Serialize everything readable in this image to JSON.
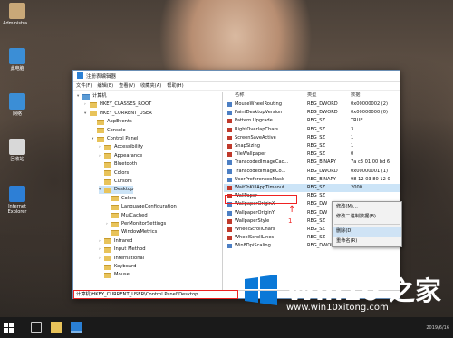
{
  "desktop": {
    "icons": [
      {
        "label": "Administra...",
        "color": "#c9a878"
      },
      {
        "label": "此电脑",
        "color": "#3b8ed6"
      },
      {
        "label": "网络",
        "color": "#3b8ed6"
      },
      {
        "label": "回收站",
        "color": "#d8d8d8"
      },
      {
        "label": "Internet Explorer",
        "color": "#2d7fd6"
      }
    ]
  },
  "window": {
    "title": "注册表编辑器",
    "menu": [
      "文件(F)",
      "编辑(E)",
      "查看(V)",
      "收藏夹(A)",
      "帮助(H)"
    ],
    "status_path": "计算机\\HKEY_CURRENT_USER\\Control Panel\\Desktop"
  },
  "tree": [
    {
      "label": "计算机",
      "exp": "▾",
      "level": 0
    },
    {
      "label": "HKEY_CLASSES_ROOT",
      "exp": "›",
      "level": 1
    },
    {
      "label": "HKEY_CURRENT_USER",
      "exp": "▾",
      "level": 1
    },
    {
      "label": "AppEvents",
      "exp": "›",
      "level": 2
    },
    {
      "label": "Console",
      "exp": "›",
      "level": 2
    },
    {
      "label": "Control Panel",
      "exp": "▾",
      "level": 2
    },
    {
      "label": "Accessibility",
      "exp": "›",
      "level": 3
    },
    {
      "label": "Appearance",
      "exp": "›",
      "level": 3
    },
    {
      "label": "Bluetooth",
      "exp": "",
      "level": 3
    },
    {
      "label": "Colors",
      "exp": "",
      "level": 3
    },
    {
      "label": "Cursors",
      "exp": "",
      "level": 3
    },
    {
      "label": "Desktop",
      "exp": "▾",
      "level": 3,
      "selected": true
    },
    {
      "label": "Colors",
      "exp": "",
      "level": 4
    },
    {
      "label": "LanguageConfiguration",
      "exp": "",
      "level": 4
    },
    {
      "label": "MuiCached",
      "exp": "",
      "level": 4
    },
    {
      "label": "PerMonitorSettings",
      "exp": "›",
      "level": 4
    },
    {
      "label": "WindowMetrics",
      "exp": "",
      "level": 4
    },
    {
      "label": "Infrared",
      "exp": "›",
      "level": 3
    },
    {
      "label": "Input Method",
      "exp": "›",
      "level": 3
    },
    {
      "label": "International",
      "exp": "›",
      "level": 3
    },
    {
      "label": "Keyboard",
      "exp": "",
      "level": 3
    },
    {
      "label": "Mouse",
      "exp": "",
      "level": 3
    }
  ],
  "values_header": {
    "name": "名称",
    "type": "类型",
    "data": "数据"
  },
  "values": [
    {
      "name": "MouseWheelRouting",
      "type": "REG_DWORD",
      "data": "0x00000002 (2)"
    },
    {
      "name": "PaintDesktopVersion",
      "type": "REG_DWORD",
      "data": "0x00000000 (0)"
    },
    {
      "name": "Pattern Upgrade",
      "type": "REG_SZ",
      "data": "TRUE"
    },
    {
      "name": "RightOverlapChars",
      "type": "REG_SZ",
      "data": "3"
    },
    {
      "name": "ScreenSaveActive",
      "type": "REG_SZ",
      "data": "1"
    },
    {
      "name": "SnapSizing",
      "type": "REG_SZ",
      "data": "1"
    },
    {
      "name": "TileWallpaper",
      "type": "REG_SZ",
      "data": "0"
    },
    {
      "name": "TranscodedImageCac...",
      "type": "REG_BINARY",
      "data": "7a c3 01 00 bd 6"
    },
    {
      "name": "TranscodedImageCo...",
      "type": "REG_DWORD",
      "data": "0x00000001 (1)"
    },
    {
      "name": "UserPreferencesMask",
      "type": "REG_BINARY",
      "data": "98 12 03 80 12 0"
    },
    {
      "name": "WaitToKillAppTimeout",
      "type": "REG_SZ",
      "data": "2000",
      "selected": true
    },
    {
      "name": "WallPaper",
      "type": "REG_SZ",
      "data": ""
    },
    {
      "name": "WallpaperOriginX",
      "type": "REG_DW",
      "data": ""
    },
    {
      "name": "WallpaperOriginY",
      "type": "REG_DW",
      "data": ""
    },
    {
      "name": "WallpaperStyle",
      "type": "REG_SZ",
      "data": ""
    },
    {
      "name": "WheelScrollChars",
      "type": "REG_SZ",
      "data": "3"
    },
    {
      "name": "WheelScrollLines",
      "type": "REG_SZ",
      "data": "3"
    },
    {
      "name": "Win8DpiScaling",
      "type": "REG_DWORD",
      "data": "0x00000000 (0)"
    }
  ],
  "context_menu": {
    "items": [
      "修改(M)...",
      "修改二进制数据(B)...",
      "删除(D)",
      "重命名(R)"
    ]
  },
  "annotations": {
    "arrow_label_1": "1",
    "arrow_label_2": "2"
  },
  "watermark": {
    "title": "Win10 之家",
    "url": "www.win10xitong.com"
  },
  "taskbar": {
    "clock": "2019/6/16"
  }
}
